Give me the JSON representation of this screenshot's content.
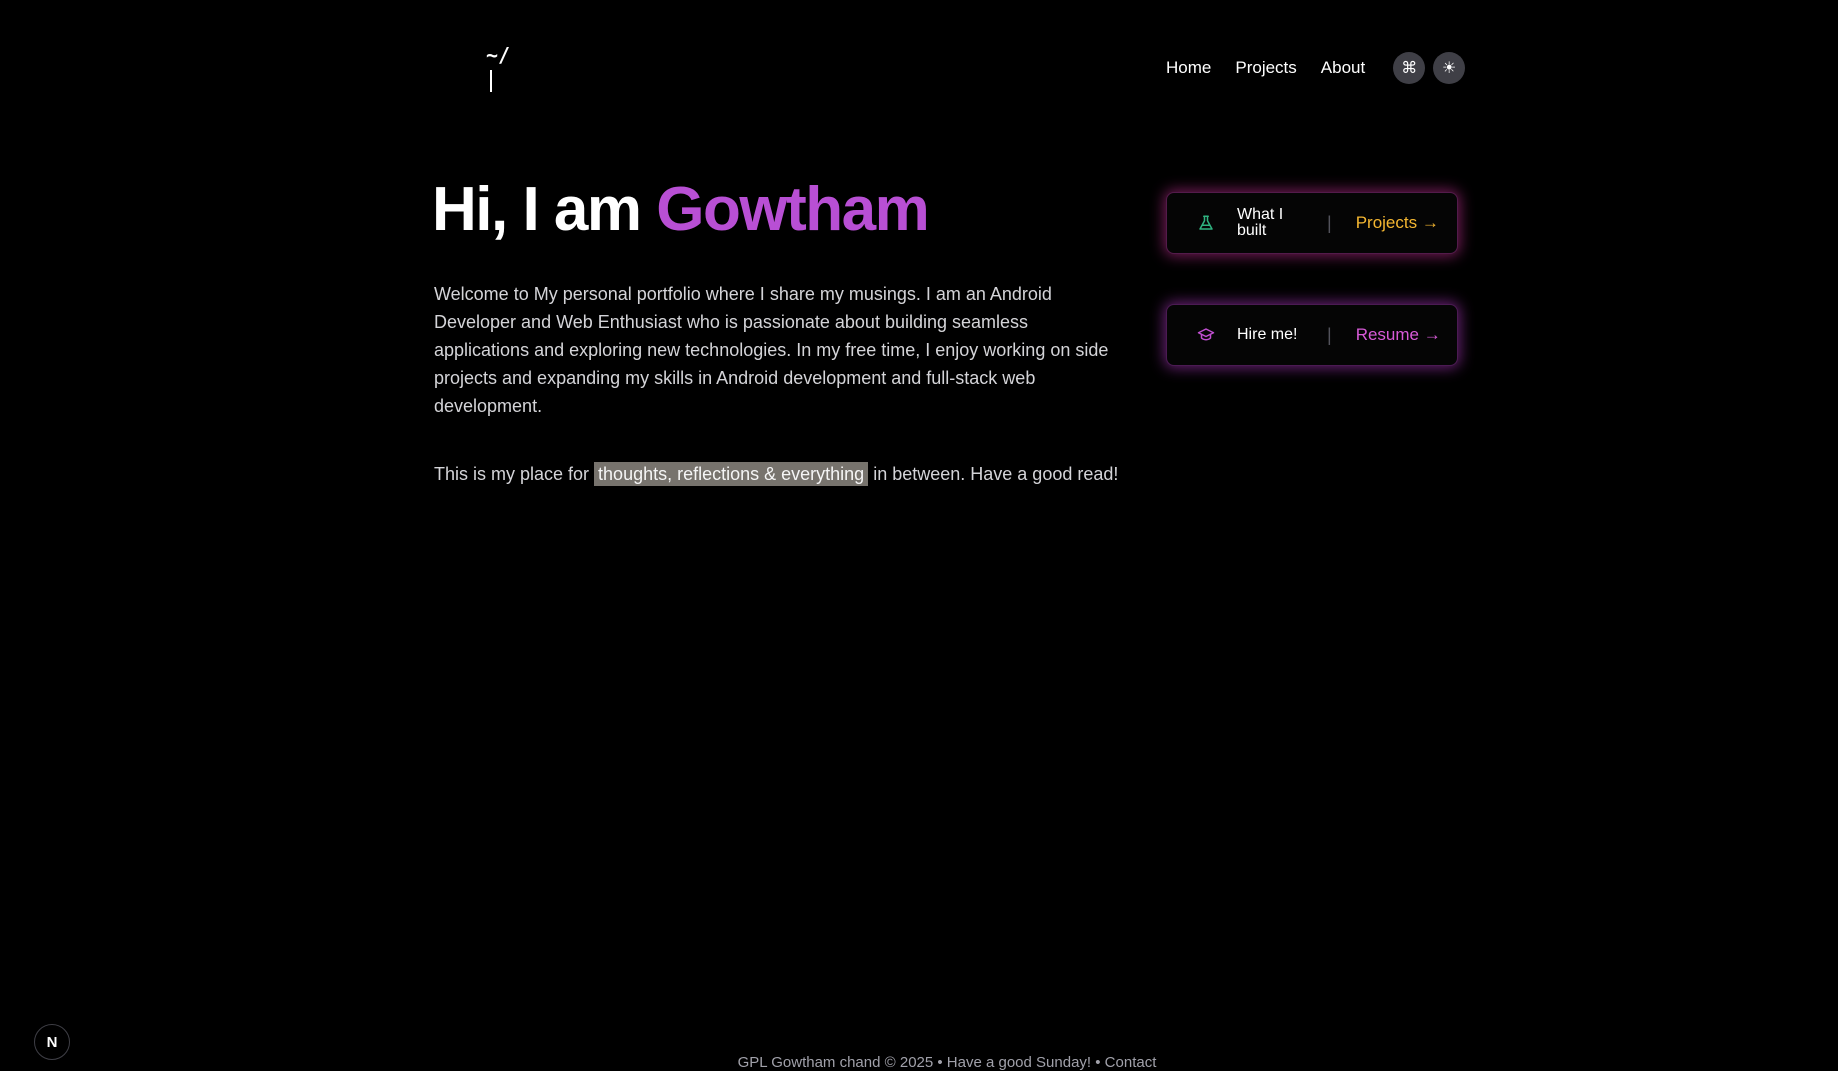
{
  "logo": {
    "text": "~/"
  },
  "nav": {
    "items": [
      {
        "label": "Home"
      },
      {
        "label": "Projects"
      },
      {
        "label": "About"
      }
    ],
    "command_icon": "command-icon",
    "theme_icon": "sun-icon"
  },
  "hero": {
    "greeting": "Hi, I am ",
    "name": "Gowtham",
    "name_color": "#b84fd4"
  },
  "intro": {
    "paragraph1": "Welcome to My personal portfolio where I share my musings. I am an Android Developer and Web Enthusiast who is passionate about building seamless applications and exploring new technologies. In my free time, I enjoy working on side projects and expanding my skills in Android development and full-stack web development.",
    "paragraph2_before": "This is my place for ",
    "paragraph2_highlight": "thoughts, reflections & everything",
    "paragraph2_after": " in between. Have a good read!"
  },
  "cards": [
    {
      "icon": "flask-icon",
      "label": "What I built",
      "link": "Projects →",
      "color": "#f5b731"
    },
    {
      "icon": "graduation-cap-icon",
      "label": "Hire me!",
      "link": "Resume →",
      "color": "#d85ad8"
    }
  ],
  "footer": {
    "text": "GPL Gowtham chand © 2025 • Have a good Sunday! • ",
    "contact": "Contact"
  },
  "badge": {
    "text": "N"
  }
}
